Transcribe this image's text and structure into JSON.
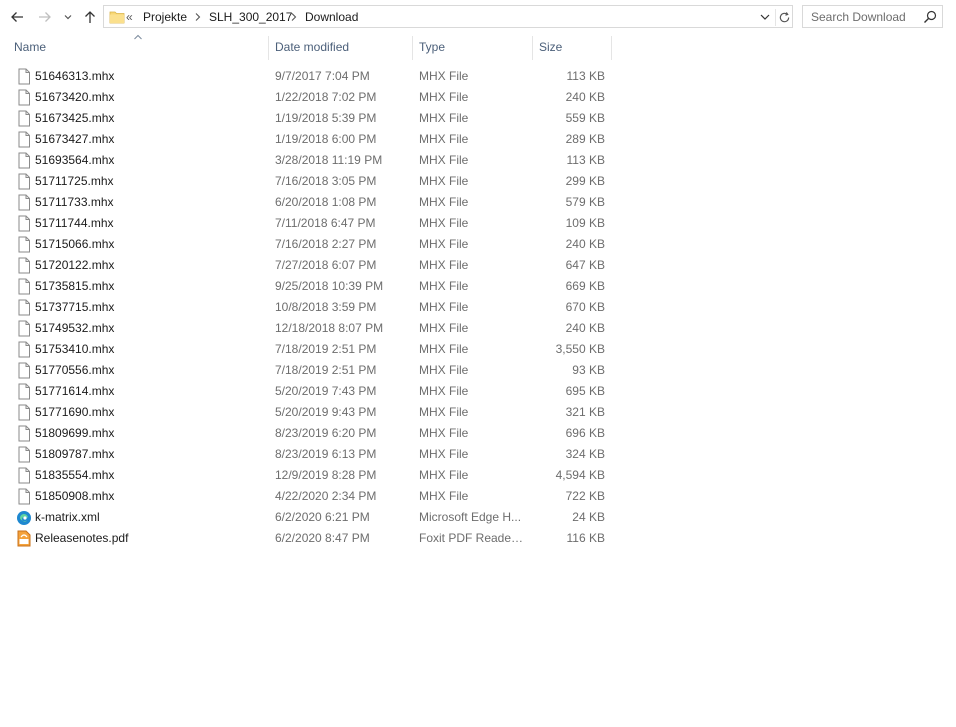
{
  "breadcrumb": {
    "overflow": "«",
    "items": [
      "Projekte",
      "SLH_300_2017",
      "Download"
    ]
  },
  "search": {
    "placeholder": "Search Download"
  },
  "columns": {
    "name": "Name",
    "date": "Date modified",
    "type": "Type",
    "size": "Size"
  },
  "files": [
    {
      "name": "51646313.mhx",
      "date": "9/7/2017 7:04 PM",
      "type": "MHX File",
      "size": "113 KB",
      "icon": "file-icon"
    },
    {
      "name": "51673420.mhx",
      "date": "1/22/2018 7:02 PM",
      "type": "MHX File",
      "size": "240 KB",
      "icon": "file-icon"
    },
    {
      "name": "51673425.mhx",
      "date": "1/19/2018 5:39 PM",
      "type": "MHX File",
      "size": "559 KB",
      "icon": "file-icon"
    },
    {
      "name": "51673427.mhx",
      "date": "1/19/2018 6:00 PM",
      "type": "MHX File",
      "size": "289 KB",
      "icon": "file-icon"
    },
    {
      "name": "51693564.mhx",
      "date": "3/28/2018 11:19 PM",
      "type": "MHX File",
      "size": "113 KB",
      "icon": "file-icon"
    },
    {
      "name": "51711725.mhx",
      "date": "7/16/2018 3:05 PM",
      "type": "MHX File",
      "size": "299 KB",
      "icon": "file-icon"
    },
    {
      "name": "51711733.mhx",
      "date": "6/20/2018 1:08 PM",
      "type": "MHX File",
      "size": "579 KB",
      "icon": "file-icon"
    },
    {
      "name": "51711744.mhx",
      "date": "7/11/2018 6:47 PM",
      "type": "MHX File",
      "size": "109 KB",
      "icon": "file-icon"
    },
    {
      "name": "51715066.mhx",
      "date": "7/16/2018 2:27 PM",
      "type": "MHX File",
      "size": "240 KB",
      "icon": "file-icon"
    },
    {
      "name": "51720122.mhx",
      "date": "7/27/2018 6:07 PM",
      "type": "MHX File",
      "size": "647 KB",
      "icon": "file-icon"
    },
    {
      "name": "51735815.mhx",
      "date": "9/25/2018 10:39 PM",
      "type": "MHX File",
      "size": "669 KB",
      "icon": "file-icon"
    },
    {
      "name": "51737715.mhx",
      "date": "10/8/2018 3:59 PM",
      "type": "MHX File",
      "size": "670 KB",
      "icon": "file-icon"
    },
    {
      "name": "51749532.mhx",
      "date": "12/18/2018 8:07 PM",
      "type": "MHX File",
      "size": "240 KB",
      "icon": "file-icon"
    },
    {
      "name": "51753410.mhx",
      "date": "7/18/2019 2:51 PM",
      "type": "MHX File",
      "size": "3,550 KB",
      "icon": "file-icon"
    },
    {
      "name": "51770556.mhx",
      "date": "7/18/2019 2:51 PM",
      "type": "MHX File",
      "size": "93 KB",
      "icon": "file-icon"
    },
    {
      "name": "51771614.mhx",
      "date": "5/20/2019 7:43 PM",
      "type": "MHX File",
      "size": "695 KB",
      "icon": "file-icon"
    },
    {
      "name": "51771690.mhx",
      "date": "5/20/2019 9:43 PM",
      "type": "MHX File",
      "size": "321 KB",
      "icon": "file-icon"
    },
    {
      "name": "51809699.mhx",
      "date": "8/23/2019 6:20 PM",
      "type": "MHX File",
      "size": "696 KB",
      "icon": "file-icon"
    },
    {
      "name": "51809787.mhx",
      "date": "8/23/2019 6:13 PM",
      "type": "MHX File",
      "size": "324 KB",
      "icon": "file-icon"
    },
    {
      "name": "51835554.mhx",
      "date": "12/9/2019 8:28 PM",
      "type": "MHX File",
      "size": "4,594 KB",
      "icon": "file-icon"
    },
    {
      "name": "51850908.mhx",
      "date": "4/22/2020 2:34 PM",
      "type": "MHX File",
      "size": "722 KB",
      "icon": "file-icon"
    },
    {
      "name": "k-matrix.xml",
      "date": "6/2/2020 6:21 PM",
      "type": "Microsoft Edge H...",
      "size": "24 KB",
      "icon": "edge-icon"
    },
    {
      "name": "Releasenotes.pdf",
      "date": "6/2/2020 8:47 PM",
      "type": "Foxit PDF Reader ...",
      "size": "116 KB",
      "icon": "pdf-icon"
    }
  ],
  "colors": {
    "header_text": "#4c607a",
    "detail_text": "#6d6d6d",
    "folder": "#f8d775",
    "pdf": "#e8841f",
    "edge": "#1e88d0"
  }
}
